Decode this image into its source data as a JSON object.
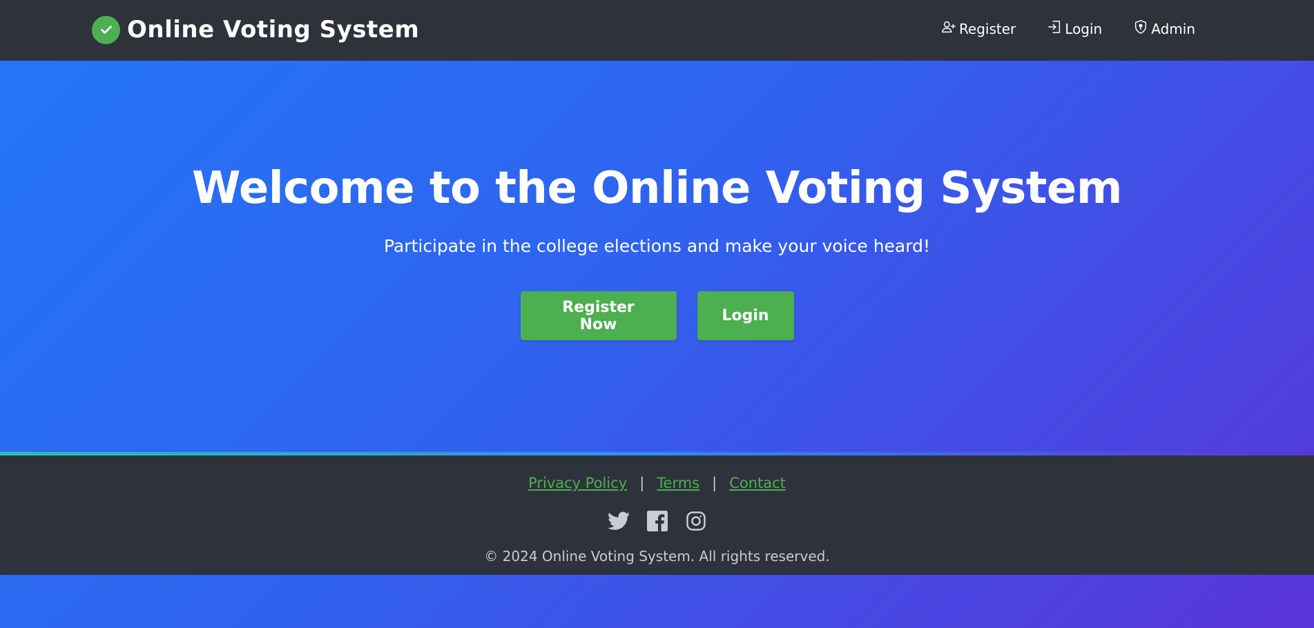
{
  "header": {
    "brand_title": "Online Voting System",
    "nav": [
      {
        "label": "Register",
        "icon": "user-plus-icon"
      },
      {
        "label": "Login",
        "icon": "sign-in-icon"
      },
      {
        "label": "Admin",
        "icon": "shield-icon"
      }
    ]
  },
  "hero": {
    "title": "Welcome to the Online Voting System",
    "subtitle": "Participate in the college elections and make your voice heard!",
    "register_button": "Register Now",
    "login_button": "Login"
  },
  "footer": {
    "links": [
      "Privacy Policy",
      "Terms",
      "Contact"
    ],
    "separator": "|",
    "socials": [
      "twitter-icon",
      "facebook-icon",
      "instagram-icon"
    ],
    "copyright": "© 2024 Online Voting System. All rights reserved."
  },
  "colors": {
    "navbar": "#2e323b",
    "accent_green": "#4caf50",
    "gradient_start": "#2476f6",
    "gradient_end": "#5a34d8"
  }
}
